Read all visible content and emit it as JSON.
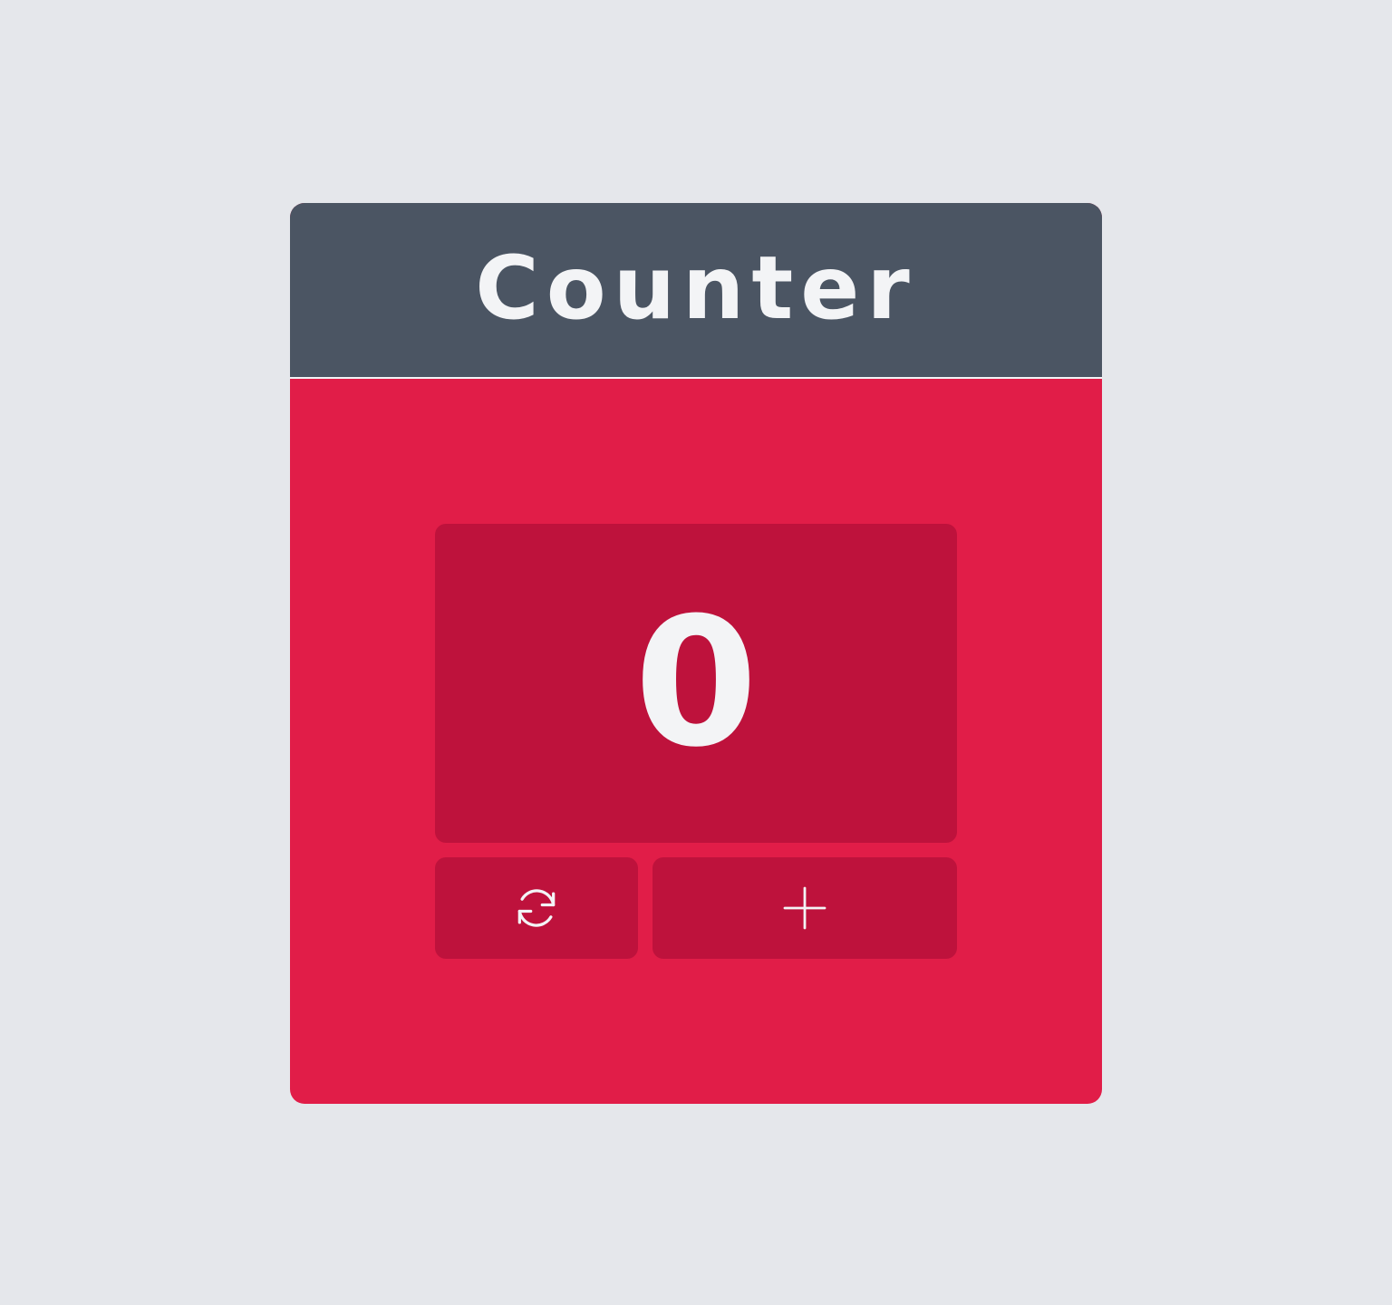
{
  "card": {
    "title": "Counter"
  },
  "counter": {
    "value": "0"
  },
  "buttons": {
    "reset": {
      "icon": "refresh-icon"
    },
    "increment": {
      "icon": "plus-icon"
    }
  },
  "colors": {
    "background": "#e5e7eb",
    "header": "#4b5563",
    "body": "#e11d48",
    "panel": "#be123c",
    "text": "#f3f4f6"
  }
}
